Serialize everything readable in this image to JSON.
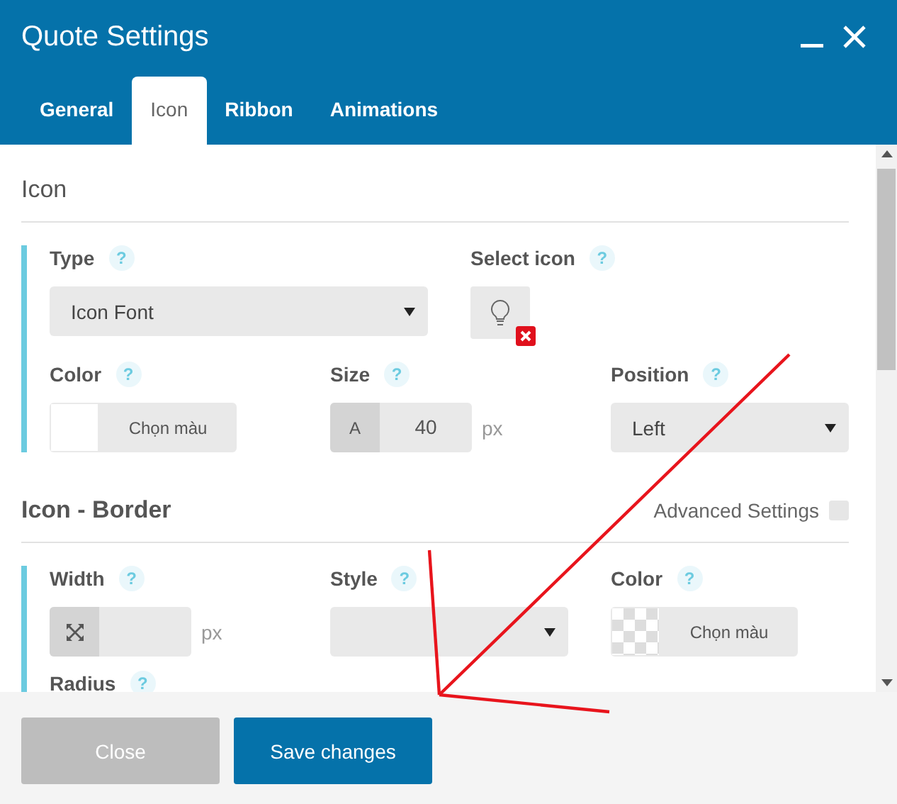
{
  "window": {
    "title": "Quote Settings"
  },
  "tabs": [
    {
      "label": "General",
      "selected": false
    },
    {
      "label": "Icon",
      "selected": true
    },
    {
      "label": "Ribbon",
      "selected": false
    },
    {
      "label": "Animations",
      "selected": false
    }
  ],
  "sections": [
    {
      "title": "Icon",
      "rows": [
        [
          {
            "kind": "select",
            "label": "Type",
            "help": "?",
            "value": "Icon Font",
            "wide": true
          },
          {
            "kind": "icon_picker",
            "label": "Select icon",
            "help": "?"
          }
        ],
        [
          {
            "kind": "color",
            "label": "Color",
            "help": "?",
            "button": "Chọn màu",
            "transparent": false
          },
          {
            "kind": "number",
            "label": "Size",
            "help": "?",
            "prefix": "A",
            "value": "40",
            "unit": "px"
          },
          {
            "kind": "select",
            "label": "Position",
            "help": "?",
            "value": "Left",
            "wide": false
          }
        ]
      ]
    },
    {
      "title": "Icon - Border",
      "advanced": {
        "label": "Advanced Settings",
        "checked": false
      },
      "rows": [
        [
          {
            "kind": "number_icon",
            "label": "Width",
            "help": "?",
            "unit": "px"
          },
          {
            "kind": "select",
            "label": "Style",
            "help": "?",
            "wide": false
          },
          {
            "kind": "color",
            "label": "Color",
            "help": "?",
            "button": "Chọn màu",
            "transparent": true
          }
        ],
        [
          {
            "kind": "label",
            "label": "Radius",
            "help": "?"
          }
        ]
      ]
    }
  ],
  "buttons": [
    {
      "label": "Close",
      "kind": "secondary"
    },
    {
      "label": "Save changes",
      "kind": "primary"
    }
  ]
}
